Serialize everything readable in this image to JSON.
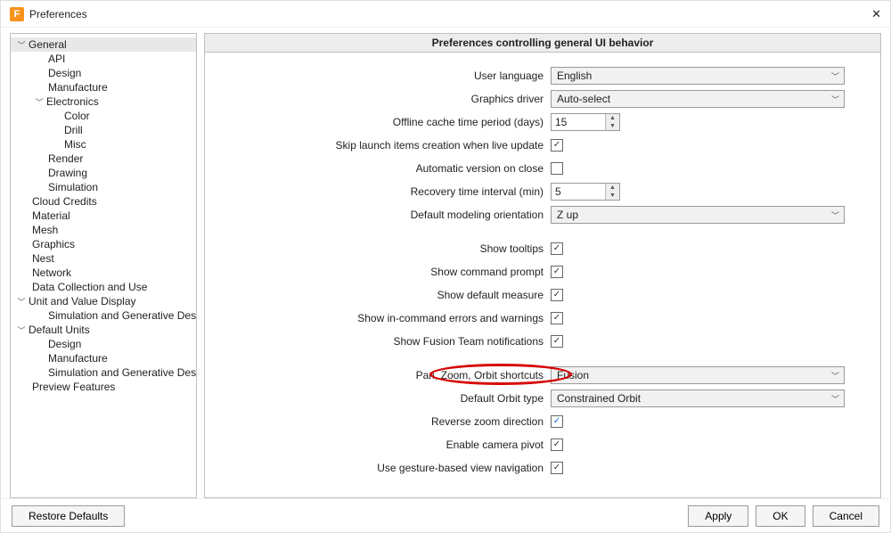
{
  "window": {
    "title": "Preferences"
  },
  "tree": {
    "general": "General",
    "api": "API",
    "design": "Design",
    "manufacture": "Manufacture",
    "electronics": "Electronics",
    "color": "Color",
    "drill": "Drill",
    "misc": "Misc",
    "render": "Render",
    "drawing": "Drawing",
    "simulation": "Simulation",
    "cloud_credits": "Cloud Credits",
    "material": "Material",
    "mesh": "Mesh",
    "graphics": "Graphics",
    "nest": "Nest",
    "network": "Network",
    "data_collection": "Data Collection and Use",
    "unit_value": "Unit and Value Display",
    "sim_gen_design1": "Simulation and Generative Design",
    "default_units": "Default Units",
    "design2": "Design",
    "manufacture2": "Manufacture",
    "sim_gen_design2": "Simulation and Generative Design",
    "preview_features": "Preview Features"
  },
  "panel": {
    "header": "Preferences controlling general UI behavior"
  },
  "fields": {
    "user_language_label": "User language",
    "user_language_value": "English",
    "graphics_driver_label": "Graphics driver",
    "graphics_driver_value": "Auto-select",
    "offline_cache_label": "Offline cache time period (days)",
    "offline_cache_value": "15",
    "skip_launch_label": "Skip launch items creation when live update",
    "auto_version_label": "Automatic version on close",
    "recovery_interval_label": "Recovery time interval (min)",
    "recovery_interval_value": "5",
    "default_orient_label": "Default modeling orientation",
    "default_orient_value": "Z up",
    "show_tooltips_label": "Show tooltips",
    "show_cmd_prompt_label": "Show command prompt",
    "show_def_measure_label": "Show default measure",
    "show_in_cmd_err_label": "Show in-command errors and warnings",
    "show_fusion_team_label": "Show Fusion Team notifications",
    "pan_zoom_label": "Pan, Zoom, Orbit shortcuts",
    "pan_zoom_value": "Fusion",
    "default_orbit_label": "Default Orbit type",
    "default_orbit_value": "Constrained Orbit",
    "reverse_zoom_label": "Reverse zoom direction",
    "enable_pivot_label": "Enable camera pivot",
    "gesture_nav_label": "Use gesture-based view navigation"
  },
  "buttons": {
    "restore": "Restore Defaults",
    "apply": "Apply",
    "ok": "OK",
    "cancel": "Cancel"
  }
}
